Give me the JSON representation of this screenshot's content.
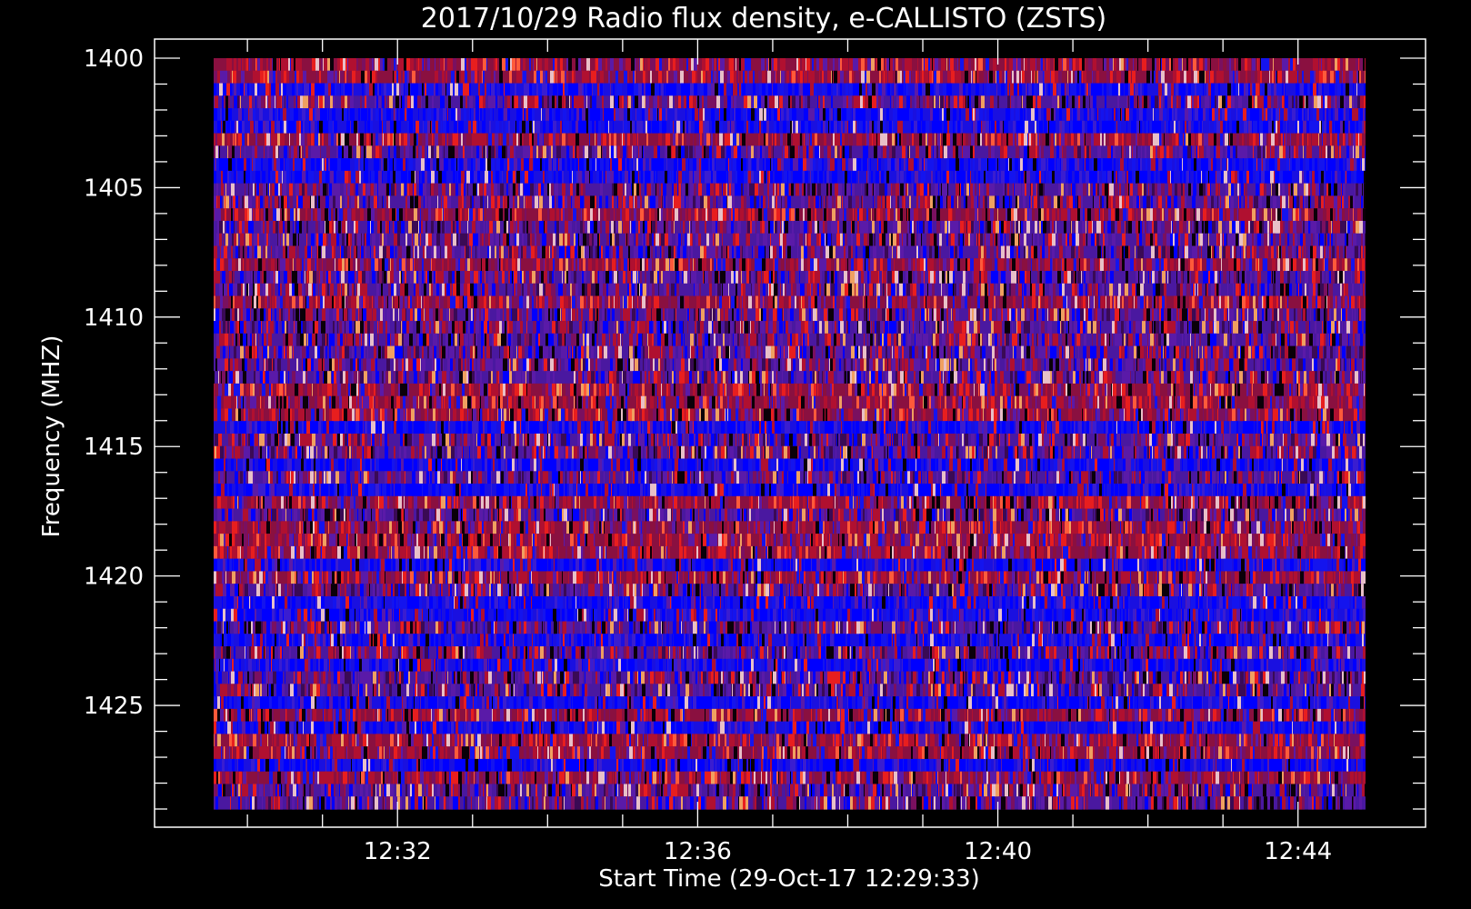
{
  "chart_data": {
    "type": "heatmap",
    "title": "2017/10/29  Radio flux density, e-CALLISTO (ZSTS)",
    "xlabel": "Start Time (29-Oct-17 12:29:33)",
    "ylabel": "Frequency (MHZ)",
    "xlim_minutes": [
      12.5,
      12.75
    ],
    "xlim": [
      "12:29:33",
      "12:44:54"
    ],
    "ylim": [
      1400,
      1429
    ],
    "y_inverted": true,
    "x_tick_labels": [
      "12:32",
      "12:36",
      "12:40",
      "12:44"
    ],
    "y_tick_labels": [
      "1400",
      "1405",
      "1410",
      "1415",
      "1420",
      "1425"
    ],
    "y_ticks": [
      1400,
      1405,
      1410,
      1415,
      1420,
      1425
    ],
    "x_ticks_min": [
      752,
      756,
      760,
      764
    ],
    "x_minor_step_min": 1,
    "y_minor_step": 1,
    "grid": false,
    "frequency_channels": 60,
    "colors": {
      "background": "#000000",
      "axes": "#ffffff",
      "text": "#ffffff",
      "palette": [
        "#0a0008",
        "#3a0a55",
        "#5a1aa8",
        "#3a1dd0",
        "#1414ee",
        "#0000ff",
        "#7a1060",
        "#b01030",
        "#e81e1e",
        "#ff5a3a",
        "#f0a060",
        "#e8c0c8"
      ]
    }
  }
}
